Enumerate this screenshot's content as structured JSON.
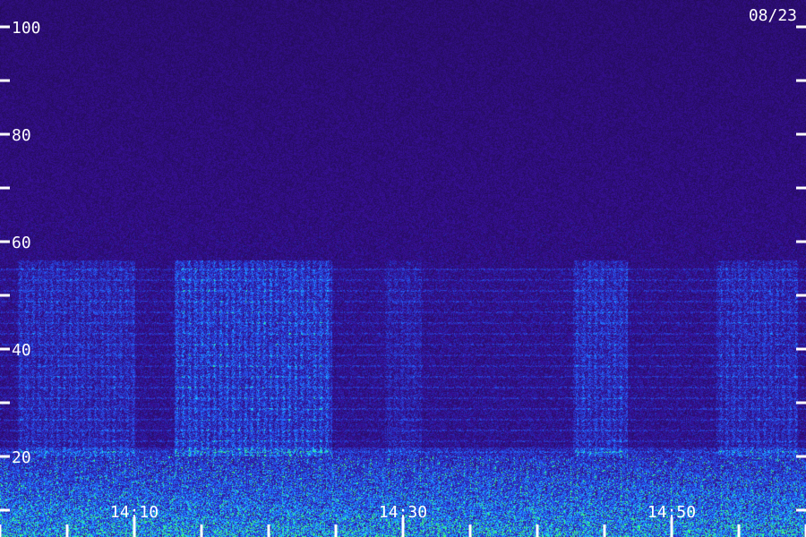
{
  "chart_data": {
    "type": "heatmap",
    "date_label": "08/23",
    "y_axis": {
      "range": [
        10,
        105
      ],
      "major_ticks": [
        100,
        80,
        60,
        40,
        20
      ],
      "minor_ticks": [
        90,
        70,
        50,
        30,
        10
      ]
    },
    "x_axis": {
      "time_labels": [
        "14:10",
        "14:30",
        "14:50"
      ]
    },
    "colors": {
      "background": "#1a0a4a",
      "low": "#2a0a8a",
      "mid": "#2a3aff",
      "high": "#20c0ff",
      "peak": "#40ff60"
    }
  }
}
